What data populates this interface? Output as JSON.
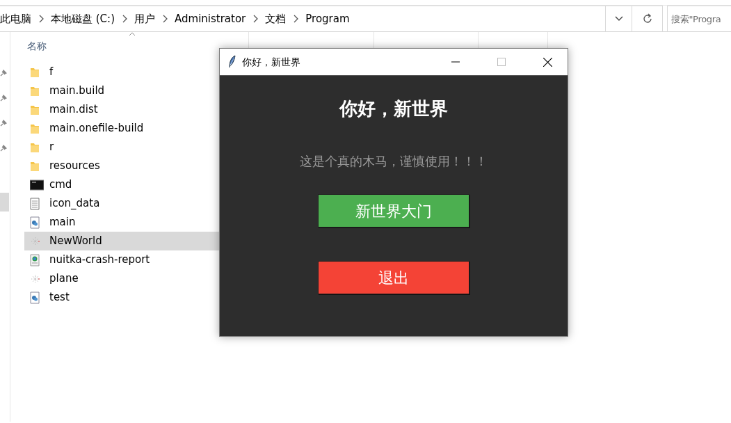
{
  "address_bar": {
    "breadcrumbs": [
      "此电脑",
      "本地磁盘 (C:)",
      "用户",
      "Administrator",
      "文档",
      "Program"
    ]
  },
  "search": {
    "placeholder": "搜索\"Progra"
  },
  "file_list": {
    "columns": [
      "名称"
    ],
    "files": [
      {
        "name": "f",
        "kind": "folder",
        "selected": false
      },
      {
        "name": "main.build",
        "kind": "folder",
        "selected": false
      },
      {
        "name": "main.dist",
        "kind": "folder",
        "selected": false
      },
      {
        "name": "main.onefile-build",
        "kind": "folder",
        "selected": false
      },
      {
        "name": "r",
        "kind": "folder",
        "selected": false
      },
      {
        "name": "resources",
        "kind": "folder",
        "selected": false
      },
      {
        "name": "cmd",
        "kind": "console",
        "selected": false
      },
      {
        "name": "icon_data",
        "kind": "text",
        "selected": false
      },
      {
        "name": "main",
        "kind": "python",
        "selected": false
      },
      {
        "name": "NewWorld",
        "kind": "program",
        "selected": true
      },
      {
        "name": "nuitka-crash-report",
        "kind": "webpage",
        "selected": false
      },
      {
        "name": "plane",
        "kind": "program",
        "selected": false
      },
      {
        "name": "test",
        "kind": "python",
        "selected": false
      }
    ]
  },
  "dialog": {
    "title": "你好，新世界",
    "heading": "你好，新世界",
    "message": "这是个真的木马，谨慎使用！！！",
    "buttons": [
      {
        "label": "新世界大门",
        "color": "#4caf50"
      },
      {
        "label": "退出",
        "color": "#f44336"
      }
    ]
  }
}
